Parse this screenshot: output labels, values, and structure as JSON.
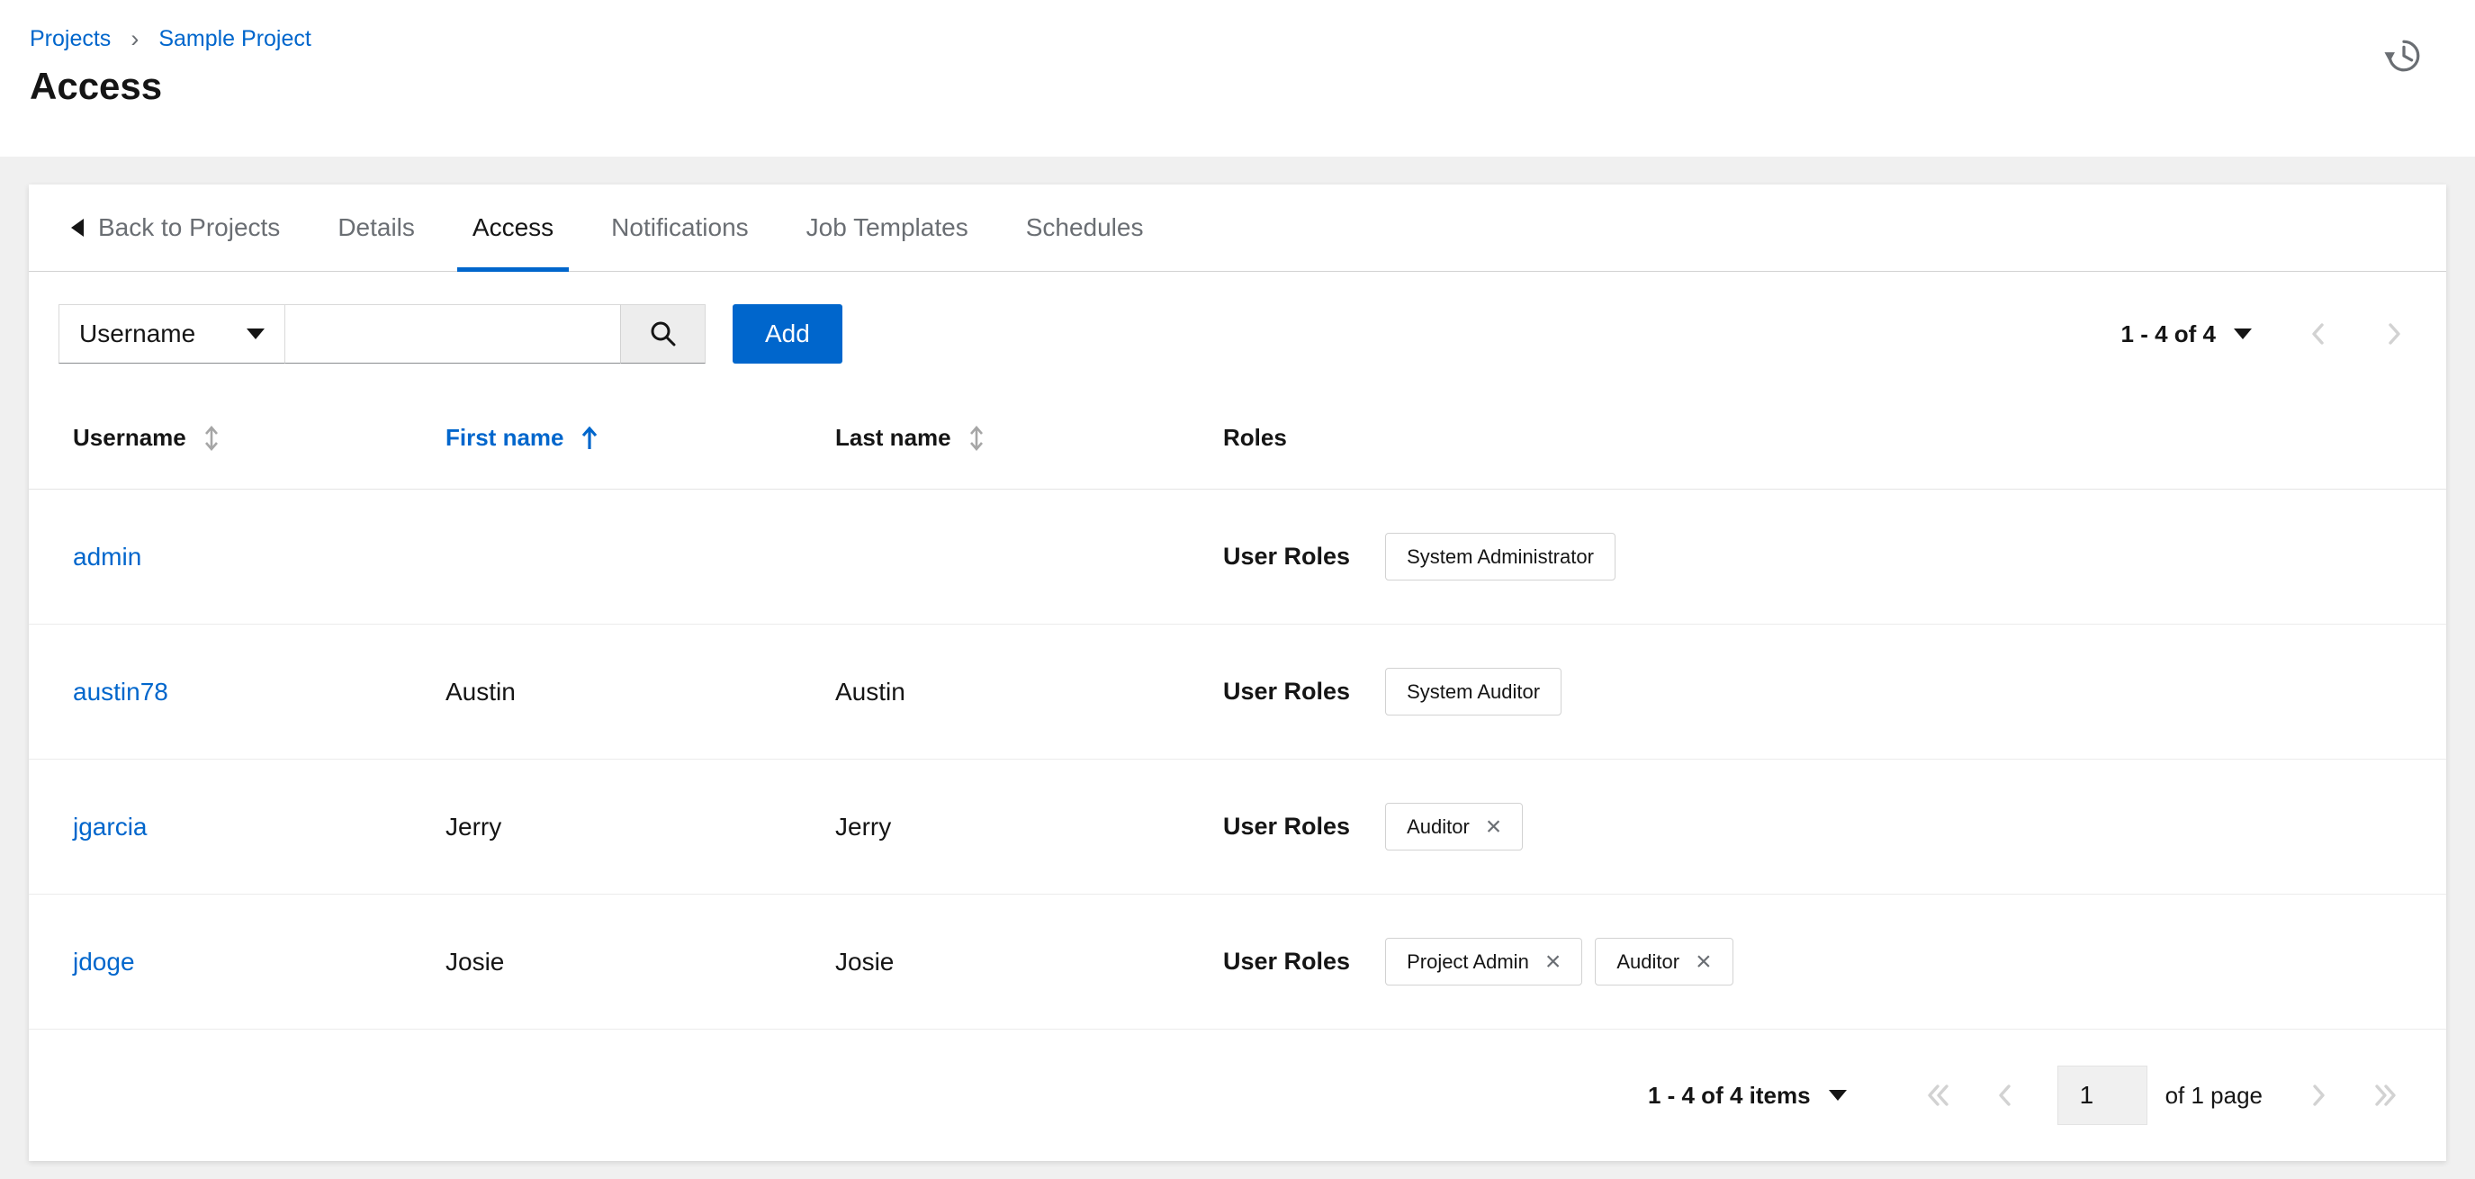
{
  "breadcrumb": {
    "items": [
      {
        "label": "Projects"
      },
      {
        "label": "Sample Project"
      }
    ],
    "separator": "›"
  },
  "page": {
    "title": "Access"
  },
  "tabs": {
    "back_label": "Back to Projects",
    "items": [
      {
        "label": "Details",
        "active": false
      },
      {
        "label": "Access",
        "active": true
      },
      {
        "label": "Notifications",
        "active": false
      },
      {
        "label": "Job Templates",
        "active": false
      },
      {
        "label": "Schedules",
        "active": false
      }
    ]
  },
  "toolbar": {
    "filter_select_value": "Username",
    "search_value": "",
    "add_label": "Add",
    "pagination_range": "1 - 4 of 4"
  },
  "table": {
    "columns": [
      {
        "label": "Username",
        "sortable": true,
        "sorted": false
      },
      {
        "label": "First name",
        "sortable": true,
        "sorted": "asc"
      },
      {
        "label": "Last name",
        "sortable": true,
        "sorted": false
      },
      {
        "label": "Roles",
        "sortable": false
      }
    ],
    "role_group_label": "User Roles",
    "rows": [
      {
        "username": "admin",
        "first_name": "",
        "last_name": "",
        "roles": [
          {
            "name": "System Administrator",
            "removable": false
          }
        ]
      },
      {
        "username": "austin78",
        "first_name": "Austin",
        "last_name": "Austin",
        "roles": [
          {
            "name": "System Auditor",
            "removable": false
          }
        ]
      },
      {
        "username": "jgarcia",
        "first_name": "Jerry",
        "last_name": "Jerry",
        "roles": [
          {
            "name": "Auditor",
            "removable": true
          }
        ]
      },
      {
        "username": "jdoge",
        "first_name": "Josie",
        "last_name": "Josie",
        "roles": [
          {
            "name": "Project Admin",
            "removable": true
          },
          {
            "name": "Auditor",
            "removable": true
          }
        ]
      }
    ]
  },
  "footer": {
    "items_range": "1 - 4 of 4 items",
    "current_page": "1",
    "of_pages": "of 1 page"
  },
  "icons": {
    "history": "clock-rotate-left",
    "search": "magnifying-glass",
    "select_caret": "caret-down",
    "back": "caret-left",
    "sort_inactive": "arrows-up-down",
    "sort_asc": "arrow-up",
    "chip_close": "×",
    "first": "double-angle-left",
    "prev": "angle-left",
    "next": "angle-right",
    "last": "double-angle-right"
  },
  "colors": {
    "accent": "#0066cc",
    "link": "#0066cc",
    "text": "#151515",
    "muted": "#6a6e73",
    "border": "#d2d2d2",
    "background": "#f0f0f0",
    "disabled": "#d2d2d2"
  }
}
